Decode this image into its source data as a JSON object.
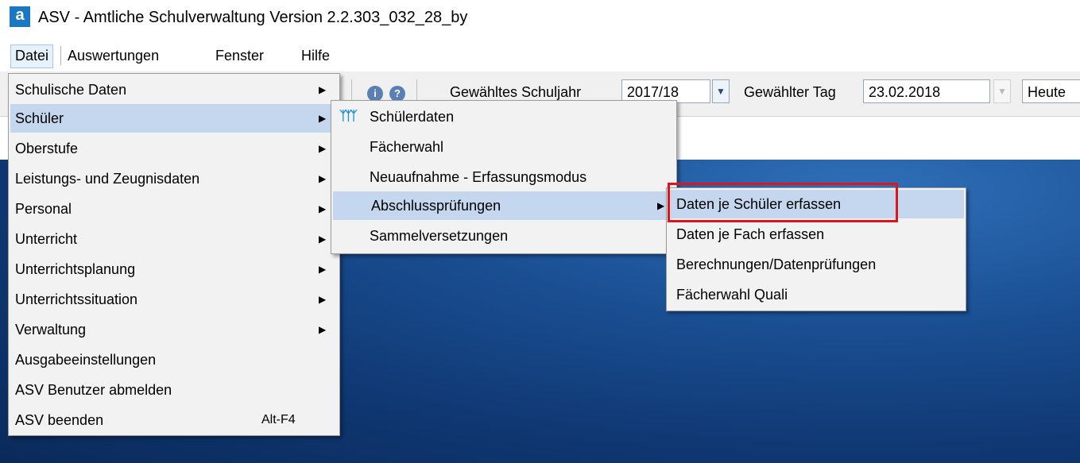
{
  "window": {
    "title": "ASV - Amtliche Schulverwaltung Version 2.2.303_032_28_by",
    "icon": "asv-app-icon"
  },
  "menubar": {
    "items": [
      "Datei",
      "Auswertungen",
      "Fenster",
      "Hilfe"
    ]
  },
  "toolbar": {
    "school_year_label": "Gewähltes Schuljahr",
    "school_year_value": "2017/18",
    "day_label": "Gewählter Tag",
    "day_value": "23.02.2018",
    "today_value": "Heute"
  },
  "datei_menu": {
    "items": [
      {
        "label": "Schulische Daten",
        "submenu": true
      },
      {
        "label": "Schüler",
        "submenu": true
      },
      {
        "label": "Oberstufe",
        "submenu": true
      },
      {
        "label": "Leistungs- und Zeugnisdaten",
        "submenu": true
      },
      {
        "label": "Personal",
        "submenu": true
      },
      {
        "label": "Unterricht",
        "submenu": true
      },
      {
        "label": "Unterrichtsplanung",
        "submenu": true
      },
      {
        "label": "Unterrichtssituation",
        "submenu": true
      },
      {
        "label": "Verwaltung",
        "submenu": true
      },
      {
        "label": "Ausgabeeinstellungen"
      },
      {
        "label": "ASV Benutzer abmelden"
      },
      {
        "label": "ASV beenden",
        "shortcut": "Alt-F4"
      }
    ]
  },
  "schueler_menu": {
    "items": [
      {
        "label": "Schülerdaten",
        "icon": "students-icon"
      },
      {
        "label": "Fächerwahl"
      },
      {
        "label": "Neuaufnahme - Erfassungsmodus"
      },
      {
        "label": "Abschlussprüfungen",
        "submenu": true
      },
      {
        "label": "Sammelversetzungen"
      }
    ]
  },
  "abschluss_menu": {
    "items": [
      {
        "label": "Daten je Schüler erfassen"
      },
      {
        "label": "Daten je Fach erfassen"
      },
      {
        "label": "Berechnungen/Datenprüfungen"
      },
      {
        "label": "Fächerwahl Quali"
      }
    ]
  },
  "colors": {
    "highlight": "#c5d7ee",
    "annotation": "#e0141b",
    "desktop": "#1a4f93"
  }
}
